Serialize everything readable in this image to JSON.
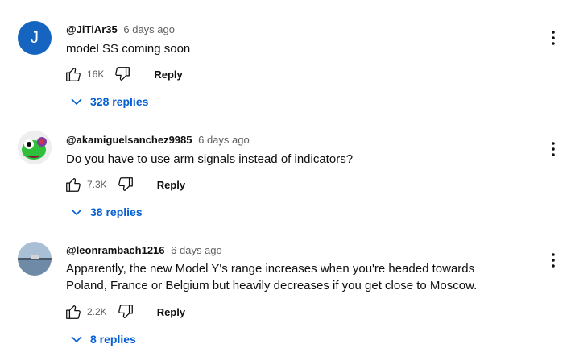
{
  "comments": [
    {
      "avatar_letter": "J",
      "author": "@JiTiAr35",
      "time": "6 days ago",
      "text": "model SS coming soon",
      "likes": "16K",
      "reply_label": "Reply",
      "replies": "328 replies"
    },
    {
      "author": "@akamiguelsanchez9985",
      "time": "6 days ago",
      "text": "Do you have to use arm signals instead of indicators?",
      "likes": "7.3K",
      "reply_label": "Reply",
      "replies": "38 replies"
    },
    {
      "author": "@leonrambach1216",
      "time": "6 days ago",
      "text": "Apparently, the new Model Y's range increases when you're headed towards Poland, France or Belgium but heavily decreases if you get close to Moscow.",
      "likes": "2.2K",
      "reply_label": "Reply",
      "replies": "8 replies"
    }
  ],
  "colors": {
    "link_blue": "#065fd4",
    "avatar_blue": "#1565c0",
    "meta_gray": "#606060"
  }
}
